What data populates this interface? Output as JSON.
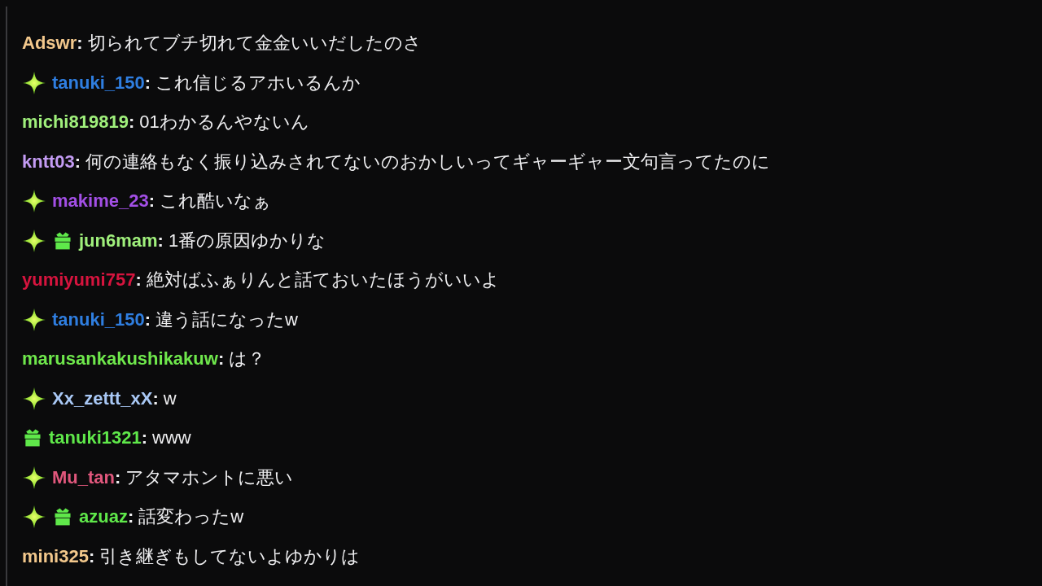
{
  "chat": {
    "messages": [
      {
        "user": "Adswr",
        "color": "#f3c88c",
        "separator": ":",
        "text": "切られてブチ切れて金金いいだしたのさ"
      },
      {
        "badges": [
          {
            "kind": "sparkle"
          }
        ],
        "user": "tanuki_150",
        "color": "#2f7ee0",
        "separator": ":",
        "text": "これ信じるアホいるんか"
      },
      {
        "user": "michi819819",
        "color": "#a0f07c",
        "separator": ":",
        "text": "01わかるんやないん"
      },
      {
        "user": "kntt03",
        "color": "#c49cf4",
        "separator": ":",
        "text": "何の連絡もなく振り込みされてないのおかしいってギャーギャー文句言ってたのに"
      },
      {
        "badges": [
          {
            "kind": "sparkle"
          }
        ],
        "user": "makime_23",
        "color": "#a34fe6",
        "separator": ":",
        "text": "これ酷いなぁ"
      },
      {
        "badges": [
          {
            "kind": "sparkle"
          },
          {
            "kind": "gift"
          }
        ],
        "user": "jun6mam",
        "color": "#a0f07c",
        "separator": ":",
        "text": "1番の原因ゆかりな"
      },
      {
        "user": "yumiyumi757",
        "color": "#d6143e",
        "separator": ":",
        "text": "絶対ばふぁりんと話ておいたほうがいいよ"
      },
      {
        "badges": [
          {
            "kind": "sparkle"
          }
        ],
        "user": "tanuki_150",
        "color": "#2f7ee0",
        "separator": ":",
        "text": "違う話になったw"
      },
      {
        "user": "marusankakushikakuw",
        "color": "#6fe84c",
        "separator": ":",
        "text": "は？"
      },
      {
        "badges": [
          {
            "kind": "sparkle"
          }
        ],
        "user": "Xx_zettt_xX",
        "color": "#a9c8f5",
        "separator": ":",
        "text": "w"
      },
      {
        "badges": [
          {
            "kind": "gift"
          }
        ],
        "user": "tanuki1321",
        "color": "#5fe84a",
        "separator": ":",
        "text": "www"
      },
      {
        "badges": [
          {
            "kind": "sparkle"
          }
        ],
        "user": "Mu_tan",
        "color": "#e0577c",
        "separator": ":",
        "text": "アタマホントに悪い"
      },
      {
        "badges": [
          {
            "kind": "sparkle"
          },
          {
            "kind": "gift"
          }
        ],
        "user": "azuaz",
        "color": "#5fe84a",
        "separator": ":",
        "text": "話変わったw"
      },
      {
        "user": "mini325",
        "color": "#f3c88c",
        "separator": ":",
        "text": "引き継ぎもしてないよゆかりは"
      }
    ]
  }
}
